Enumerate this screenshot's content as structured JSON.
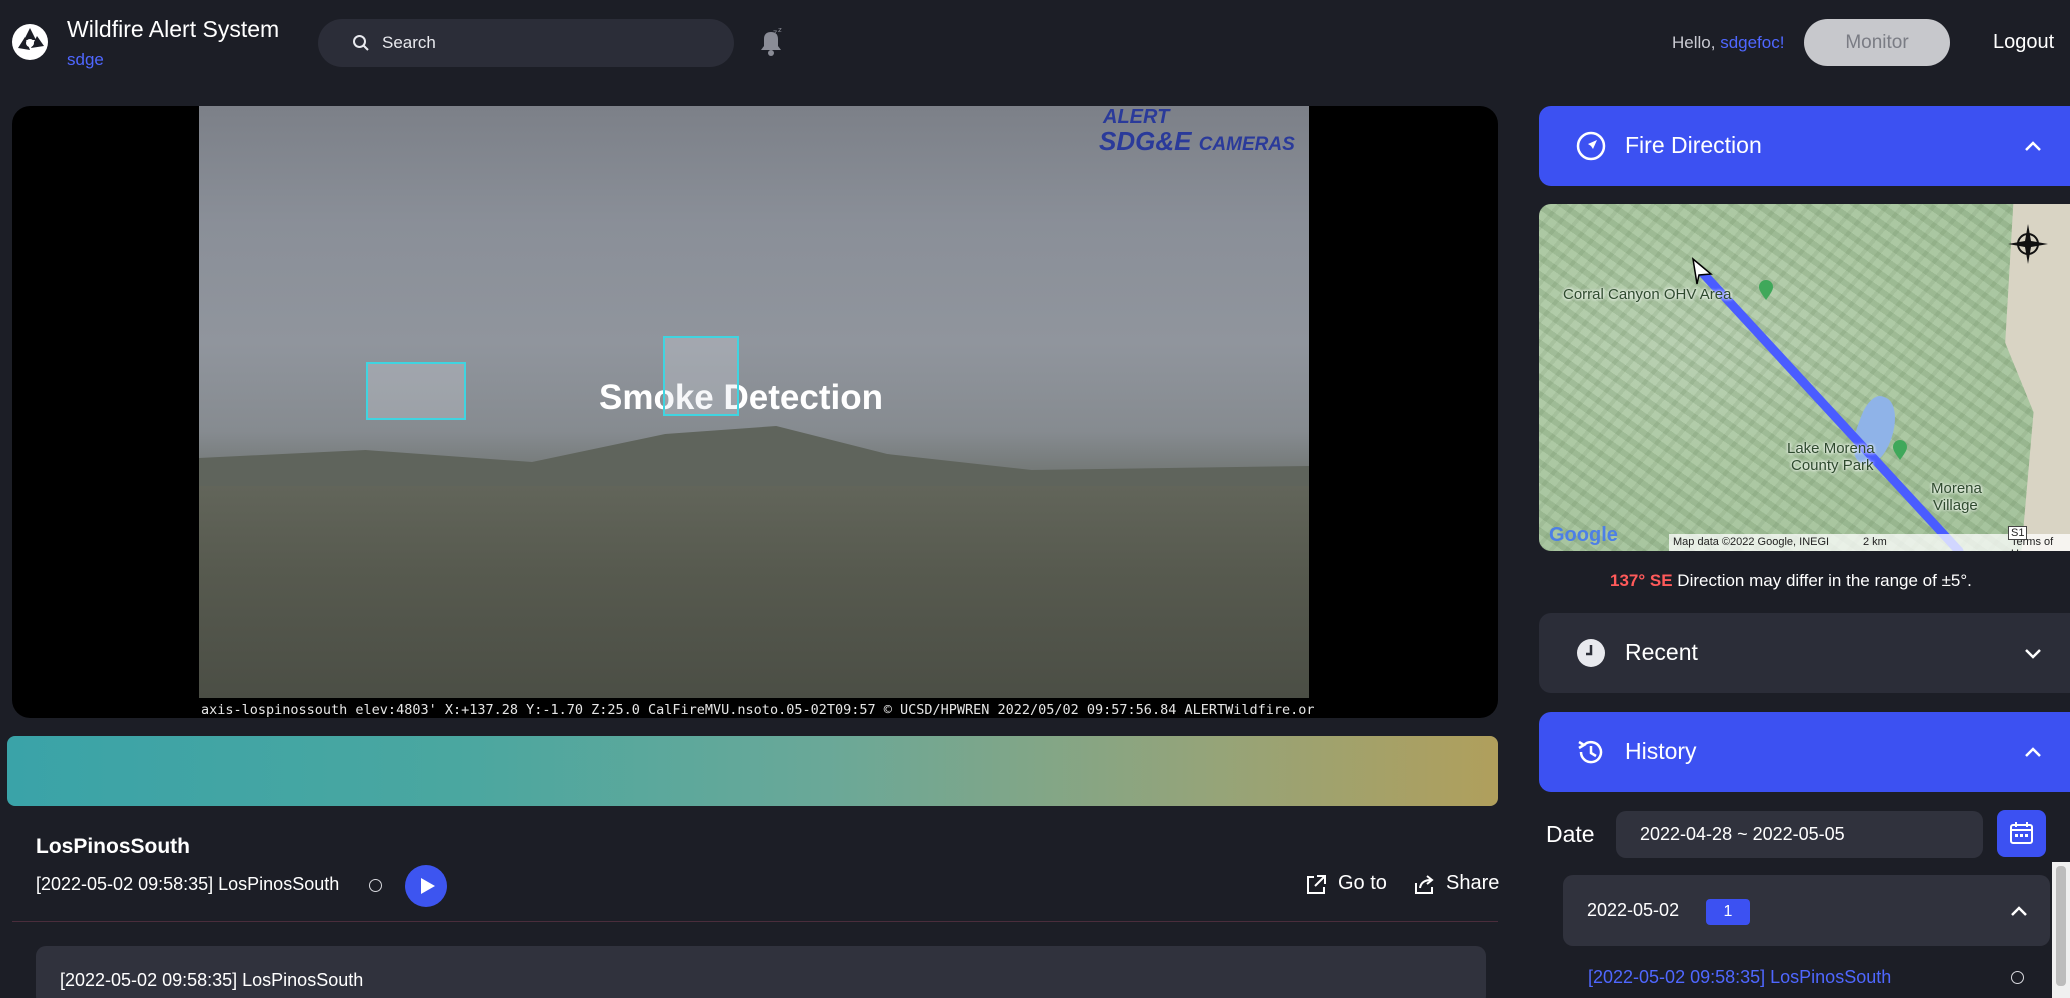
{
  "header": {
    "app_title": "Wildfire Alert System",
    "app_subtitle": "sdge",
    "search_placeholder": "Search",
    "greeting": "Hello, ",
    "username": "sdgefoc!",
    "monitor_label": "Monitor",
    "logout_label": "Logout"
  },
  "video": {
    "watermark_line1": "ALERT",
    "watermark_brand": "SDG&E",
    "watermark_cameras": "CAMERAS",
    "detection_label": "Smoke Detection",
    "overlay_text": "axis-lospinossouth elev:4803' X:+137.28 Y:-1.70 Z:25.0 CalFireMVU.nsoto.05-02T09:57 © UCSD/HPWREN 2022/05/02 09:57:56.84 ALERTWildfire.or"
  },
  "camera": {
    "name": "LosPinosSouth",
    "event_time": "[2022-05-02 09:58:35] LosPinosSouth",
    "goto_label": "Go to",
    "share_label": "Share",
    "event_card": "[2022-05-02 09:58:35] LosPinosSouth"
  },
  "panels": {
    "fire_direction": {
      "title": "Fire Direction",
      "expanded": true
    },
    "recent": {
      "title": "Recent",
      "expanded": false
    },
    "history": {
      "title": "History",
      "expanded": true
    }
  },
  "map": {
    "labels": {
      "corral": "Corral Canyon OHV Area",
      "lake_1": "Lake Morena",
      "lake_2": "County Park",
      "village_1": "Morena",
      "village_2": "Village"
    },
    "provider": "Google",
    "attribution": "Map data ©2022 Google, INEGI",
    "scale": "2 km",
    "terms": "Terms of Use",
    "route_sign": "S1"
  },
  "direction": {
    "degrees": "137° SE",
    "note": " Direction may differ in the range of ±5°."
  },
  "history": {
    "date_label": "Date",
    "date_range": "2022-04-28 ~ 2022-05-05",
    "groups": [
      {
        "date": "2022-05-02",
        "count": "1",
        "items": [
          "[2022-05-02 09:58:35] LosPinosSouth"
        ]
      }
    ]
  },
  "colors": {
    "accent": "#3c51f2",
    "link": "#4f67ff",
    "background": "#1c1e26",
    "card": "#30323d",
    "direction_highlight": "#ff5a5a",
    "detection_box": "#40d4e0"
  }
}
